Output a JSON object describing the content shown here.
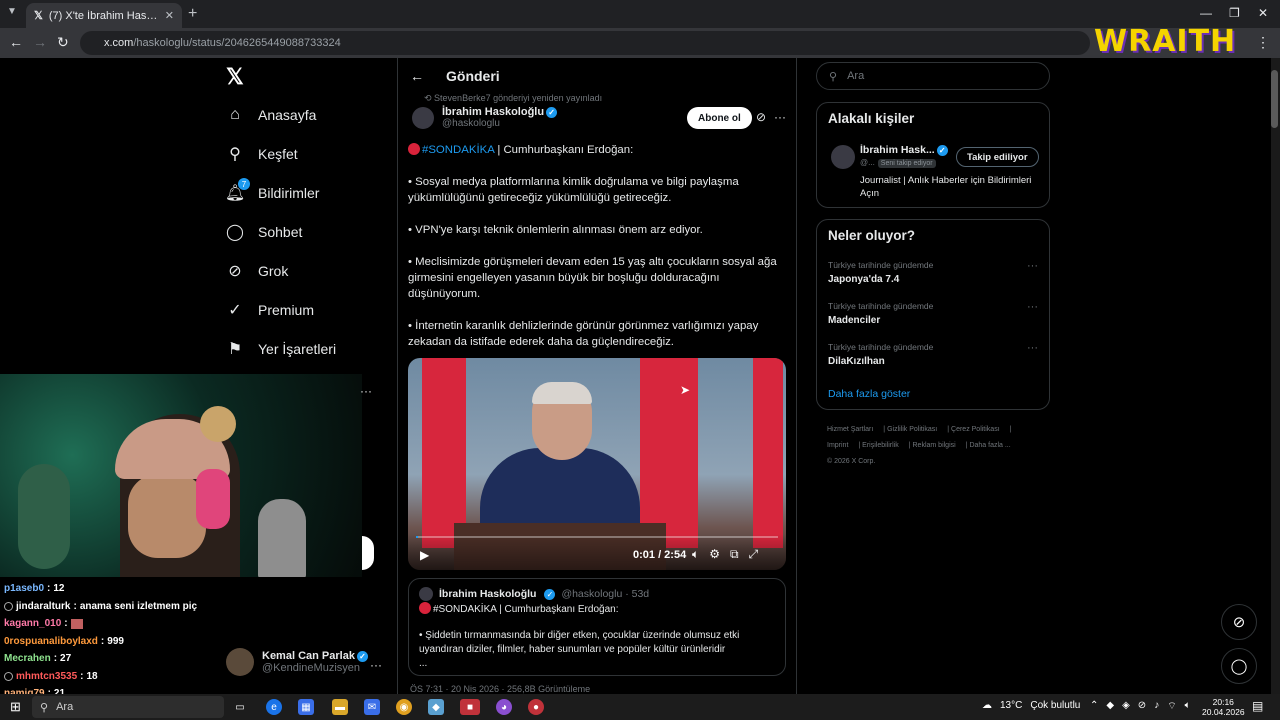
{
  "browser": {
    "tab_title": "(7) X'te İbrahim Haskoloğlu: \"",
    "url_host": "x.com",
    "url_path": "/haskologlu/status/2046265449088733324"
  },
  "overlay": {
    "logo_text": "WRAITH"
  },
  "nav": {
    "items": [
      {
        "label": "Anasayfa",
        "icon": "home-icon"
      },
      {
        "label": "Keşfet",
        "icon": "search-icon"
      },
      {
        "label": "Bildirimler",
        "icon": "bell-icon",
        "badge": "7"
      },
      {
        "label": "Sohbet",
        "icon": "chat-icon"
      },
      {
        "label": "Grok",
        "icon": "grok-icon"
      },
      {
        "label": "Premium",
        "icon": "verified-icon"
      },
      {
        "label": "Yer İşaretleri",
        "icon": "bookmark-icon"
      }
    ]
  },
  "account": {
    "name": "Kemal Can Parlak",
    "handle": "@KendineMuzisyen"
  },
  "chat": [
    {
      "user": "p1aseb0",
      "msg": "12",
      "color": "#7ab8ff"
    },
    {
      "user": "jindaralturk",
      "msg": "anama seni izletmem piç",
      "color": "#ffffff"
    },
    {
      "user": "kagann_010",
      "msg": "",
      "color": "#ff7aa8"
    },
    {
      "user": "0rospuanaliboylaxd",
      "msg": "999",
      "color": "#ff9a3c"
    },
    {
      "user": "Mecrahen",
      "msg": "27",
      "color": "#8fe38f"
    },
    {
      "user": "mhmtcn3535",
      "msg": "18",
      "color": "#ff5a5a"
    },
    {
      "user": "namiq79",
      "msg": "21",
      "color": "#ffb27a"
    }
  ],
  "post": {
    "header": "Gönderi",
    "repost_note": "StevenBerke7 gönderiyi yeniden yayınladı",
    "author_name": "İbrahim Haskoloğlu",
    "author_handle": "@haskologlu",
    "follow_label": "Abone ol",
    "lead_hashtag": "#SONDAKİKA",
    "lead_rest": " | Cumhurbaşkanı Erdoğan:",
    "paragraphs": [
      "• Sosyal medya platformlarına kimlik doğrulama ve bilgi paylaşma yükümlülüğünü getireceğiz yükümlülüğü getireceğiz.",
      "• VPN'ye karşı teknik önlemlerin alınması önem arz ediyor.",
      "• Meclisimizde görüşmeleri devam eden 15 yaş altı çocukların sosyal ağa girmesini engelleyen yasanın büyük bir boşluğu dolduracağını düşünüyorum.",
      "• İnternetin karanlık dehlizlerinde görünür görünmez varlığımızı yapay zekadan da istifade ederek daha da güçlendireceğiz."
    ],
    "video": {
      "time": "0:01 / 2:54",
      "progress": 0.006
    },
    "quote": {
      "author_name": "İbrahim Haskoloğlu",
      "meta": "@haskologlu · 53d",
      "lead": "#SONDAKİKA | Cumhurbaşkanı Erdoğan:",
      "body": "• Şiddetin tırmanmasında bir diğer etken, çocuklar üzerinde olumsuz etki uyandıran diziler, filmler, haber sunumları ve popüler kültür ürünleridir",
      "ellipsis": "..."
    },
    "below_quote": "ÖS 7:31 · 20 Nis 2026 · 256,8B Görüntüleme"
  },
  "sidebar": {
    "search_placeholder": "Ara",
    "related_title": "Alakalı kişiler",
    "related": {
      "name": "İbrahim Hask...",
      "handle": "@...",
      "follows_you": "Seni takip ediyor",
      "button": "Takip ediliyor",
      "bio": "Journalist | Anlık Haberler için Bildirimleri Açın"
    },
    "trends_title": "Neler oluyor?",
    "trends": [
      {
        "context": "Türkiye tarihinde gündemde",
        "name": "Japonya'da 7.4"
      },
      {
        "context": "Türkiye tarihinde gündemde",
        "name": "Madenciler"
      },
      {
        "context": "Türkiye tarihinde gündemde",
        "name": "DilaKızılhan"
      }
    ],
    "show_more": "Daha fazla göster",
    "footer_links": [
      "Hizmet Şartları",
      "Gizlilik Politikası",
      "Çerez Politikası",
      "Imprint",
      "Erişilebilirlik",
      "Reklam bilgisi",
      "Daha fazla ..."
    ],
    "copyright": "© 2026 X Corp."
  },
  "taskbar": {
    "search": "Ara",
    "weather": "13°C",
    "weather_desc": "Çok bulutlu",
    "time": "20:16",
    "date": "20.04.2026"
  }
}
